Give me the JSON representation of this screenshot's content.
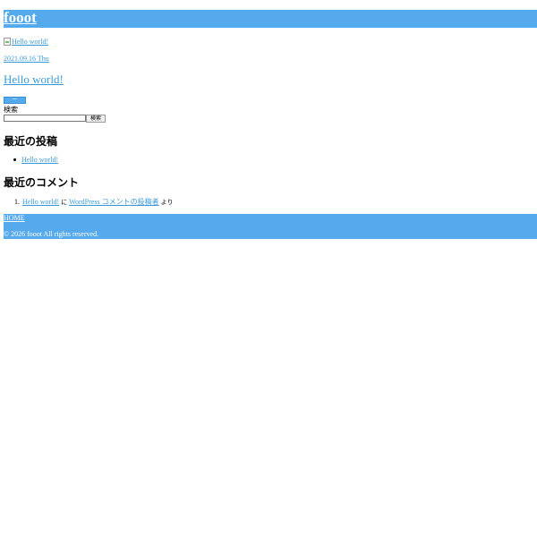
{
  "site": {
    "title": "fooot"
  },
  "post": {
    "thumbnail_alt": "Hello world!",
    "date": "2021.09.16 Thu",
    "title": "Hello world!"
  },
  "sidebar": {
    "widget_button_label": "ー",
    "search": {
      "label": "検索",
      "placeholder": "",
      "value": "",
      "submit_label": "検索"
    },
    "recent_posts": {
      "heading": "最近の投稿",
      "items": [
        "Hello world!"
      ]
    },
    "recent_comments": {
      "heading": "最近のコメント",
      "items": [
        {
          "post": "Hello world!",
          "connector": "に",
          "author": "WordPress コメントの投稿者",
          "suffix": "より"
        }
      ]
    }
  },
  "footer": {
    "home_label": "HOME",
    "copyright": "© 2026 fooot All rights reserved."
  },
  "colors": {
    "accent": "#55aaee",
    "link": "#3a9ad9"
  }
}
